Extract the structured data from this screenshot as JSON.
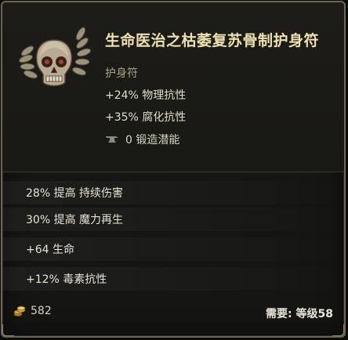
{
  "item": {
    "title": "生命医治之枯萎复苏骨制护身符",
    "type": "护身符",
    "icon": "skull-amulet-icon",
    "implicit_stats": [
      "+24% 物理抗性",
      "+35% 腐化抗性"
    ],
    "forge": {
      "icon": "anvil-icon",
      "text": "0 锻造潜能"
    },
    "affixes": [
      "28% 提高 持续伤害",
      "30% 提高 魔力再生",
      "+64 生命",
      "+12% 毒素抗性"
    ]
  },
  "footer": {
    "value_icon": "gold-coin-icon",
    "value": "582",
    "requirement": "需要: 等级58"
  },
  "colors": {
    "title": "#ece1b0",
    "border": "#6b6652",
    "background": "#151513"
  }
}
